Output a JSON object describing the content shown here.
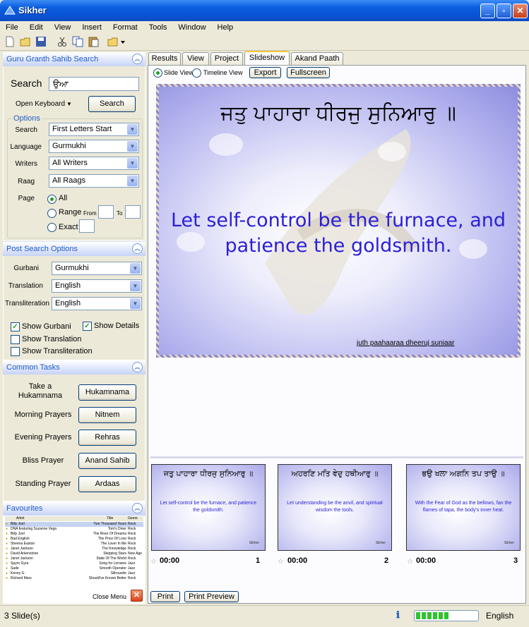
{
  "app": {
    "title": "Sikher"
  },
  "menu": [
    "File",
    "Edit",
    "View",
    "Insert",
    "Format",
    "Tools",
    "Window",
    "Help"
  ],
  "search_panel": {
    "header": "Guru Granth Sahib Search",
    "search_label": "Search",
    "search_value": "ਉਆ",
    "open_keyboard": "Open Keyboard",
    "search_button": "Search",
    "options_label": "Options",
    "search_mode_label": "Search",
    "search_mode": "First Letters Start",
    "language_label": "Language",
    "language": "Gurmukhi",
    "writers_label": "Writers",
    "writers": "All Writers",
    "raag_label": "Raag",
    "raag": "All Raags",
    "page_label": "Page",
    "page_all": "All",
    "page_range": "Range",
    "from_label": "From",
    "to_label": "To",
    "page_exact": "Exact"
  },
  "post_search": {
    "header": "Post Search Options",
    "gurbani_label": "Gurbani",
    "gurbani": "Gurmukhi",
    "translation_label": "Translation",
    "translation": "English",
    "transliteration_label": "Transliteration",
    "transliteration": "English",
    "show_gurbani": "Show Gurbani",
    "show_details": "Show Details",
    "show_translation": "Show Translation",
    "show_transliteration": "Show Transliteration"
  },
  "common_tasks": {
    "header": "Common Tasks",
    "items": [
      {
        "label": "Take a Hukamnama",
        "button": "Hukamnama"
      },
      {
        "label": "Morning Prayers",
        "button": "Nitnem"
      },
      {
        "label": "Evening Prayers",
        "button": "Rehras"
      },
      {
        "label": "Bliss Prayer",
        "button": "Anand Sahib"
      },
      {
        "label": "Standing Prayer",
        "button": "Ardaas"
      }
    ]
  },
  "favourites": {
    "header": "Favourites",
    "columns": [
      "Artist",
      "Title",
      "Genre"
    ],
    "rows": [
      [
        "Billy Joel",
        "Two Thousand Years",
        "Rock"
      ],
      [
        "DNA featuring Suzanne Vega",
        "Tom's Diner",
        "Rock"
      ],
      [
        "Billy Joel",
        "The River Of Dreams",
        "Rock"
      ],
      [
        "Bad English",
        "The Price Of Love",
        "Rock"
      ],
      [
        "Sheena Easton",
        "The Lover In Me",
        "Rock"
      ],
      [
        "Janet Jackson",
        "The Knowledge",
        "Rock"
      ],
      [
        "David Arkenstone",
        "Stepping Stars",
        "New Age"
      ],
      [
        "Janet Jackson",
        "State Of The World",
        "Rock"
      ],
      [
        "Spyro Gyra",
        "Song for Lorraine",
        "Jazz"
      ],
      [
        "Sade",
        "Smooth Operator",
        "Jazz"
      ],
      [
        "Kenny G",
        "Silhouette",
        "Jazz"
      ],
      [
        "Richard Marx",
        "Should've Known Better",
        "Rock"
      ]
    ],
    "close_menu": "Close Menu"
  },
  "tabs": [
    "Results",
    "View",
    "Project",
    "Slideshow",
    "Akand Paath"
  ],
  "active_tab": "Slideshow",
  "slideshow": {
    "slide_view": "Slide View",
    "timeline_view": "Timeline View",
    "export": "Export",
    "fullscreen": "Fullscreen",
    "gurmukhi": "ਜਤੁ ਪਾਹਾਰਾ ਧੀਰਜੁ ਸੁਨਿਆਰੁ ॥",
    "translation": "Let self-control be the furnace, and patience the goldsmith.",
    "transliteration": "juth paahaaraa dheeruj suniaar",
    "print": "Print",
    "print_preview": "Print Preview"
  },
  "thumbnails": [
    {
      "gurmukhi": "ਜਤੁ ਪਾਹਾਰਾ ਧੀਰਜੁ ਸੁਨਿਆਰੁ ॥",
      "text": "Let self-control be the furnace, and patience the goldsmith.",
      "time": "00:00",
      "num": "1",
      "brand": "Sikher"
    },
    {
      "gurmukhi": "ਅਹਰਣਿ ਮਤਿ ਵੇਦੁ ਹਥੀਆਰੁ ॥",
      "text": "Let understanding be the anvil, and spiritual wisdom the tools.",
      "time": "00:00",
      "num": "2",
      "brand": "Sikher"
    },
    {
      "gurmukhi": "ਭਉ ਖਲਾ ਅਗਨਿ ਤਪ ਤਾਉ ॥",
      "text": "With the Fear of God as the bellows, fan the flames of tapa, the body's inner heat.",
      "time": "00:00",
      "num": "3",
      "brand": "Sikher"
    }
  ],
  "status": {
    "slides": "3 Slide(s)",
    "language": "English",
    "progress": 0.55
  },
  "colors": {
    "accent": "#215dc6",
    "slide_text": "#2b1fd6",
    "titlebar": "#0a54d6"
  }
}
